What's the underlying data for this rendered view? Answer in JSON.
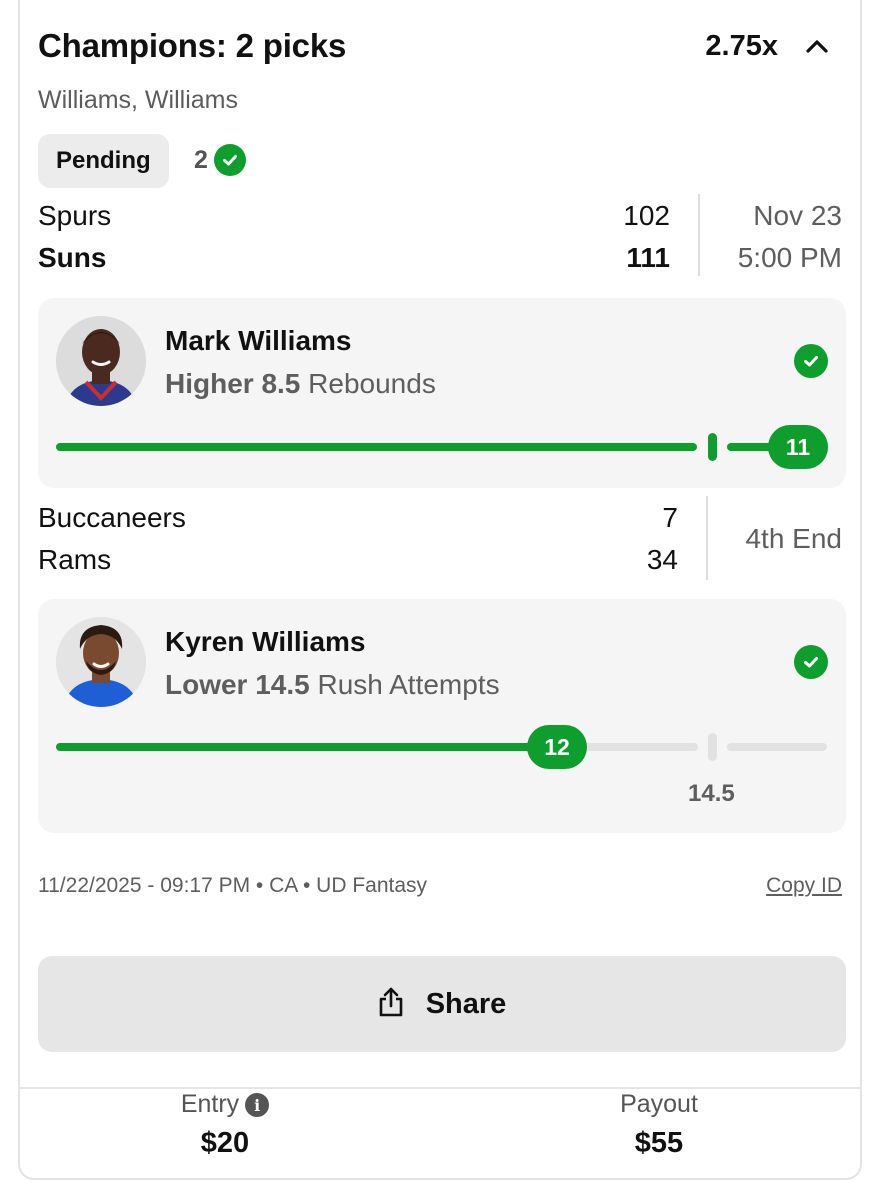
{
  "header": {
    "title": "Champions: 2 picks",
    "multiplier": "2.75x",
    "subtitle": "Williams, Williams",
    "status": "Pending",
    "correct_count": "2"
  },
  "games": [
    {
      "team1": "Spurs",
      "score1": "102",
      "team2": "Suns",
      "score2": "111",
      "meta_line1": "Nov 23",
      "meta_line2": "5:00 PM",
      "pick": {
        "player": "Mark Williams",
        "direction": "Higher 8.5",
        "stat": "Rebounds",
        "result": "11",
        "line": 8.5,
        "progress": 1.0
      }
    },
    {
      "team1": "Buccaneers",
      "score1": "7",
      "team2": "Rams",
      "score2": "34",
      "meta_line1": "4th End",
      "pick": {
        "player": "Kyren Williams",
        "direction": "Lower 14.5",
        "stat": "Rush Attempts",
        "result": "12",
        "line_label": "14.5",
        "progress": 0.83
      }
    }
  ],
  "footer": {
    "info": "11/22/2025 - 09:17 PM • CA • UD Fantasy",
    "copy_id": "Copy ID",
    "share_label": "Share",
    "entry_label": "Entry",
    "entry_value": "$20",
    "payout_label": "Payout",
    "payout_value": "$55"
  },
  "colors": {
    "accent_green": "#0d9e2e",
    "panel_bg": "#f5f5f5"
  },
  "icons": [
    "chevron-up-icon",
    "check-circle-icon",
    "share-icon",
    "info-icon"
  ]
}
